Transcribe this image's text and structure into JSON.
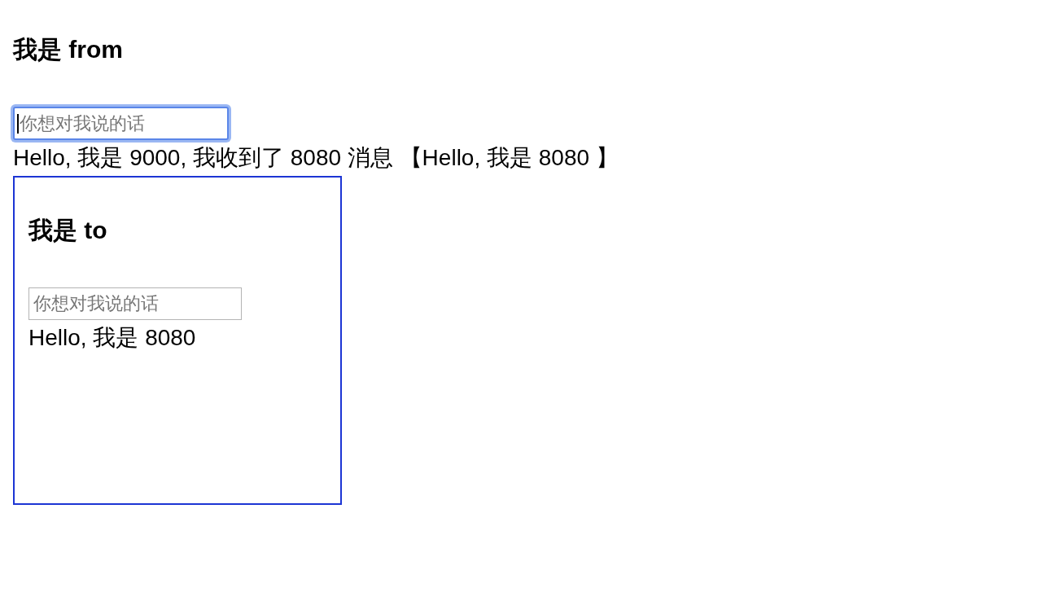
{
  "from": {
    "title": "我是 from",
    "input": {
      "placeholder": "你想对我说的话",
      "focused": true
    },
    "message": "Hello, 我是 9000, 我收到了 8080 消息 【Hello, 我是 8080 】"
  },
  "to": {
    "title": "我是 to",
    "input": {
      "placeholder": "你想对我说的话",
      "focused": false
    },
    "message": "Hello, 我是 8080"
  }
}
